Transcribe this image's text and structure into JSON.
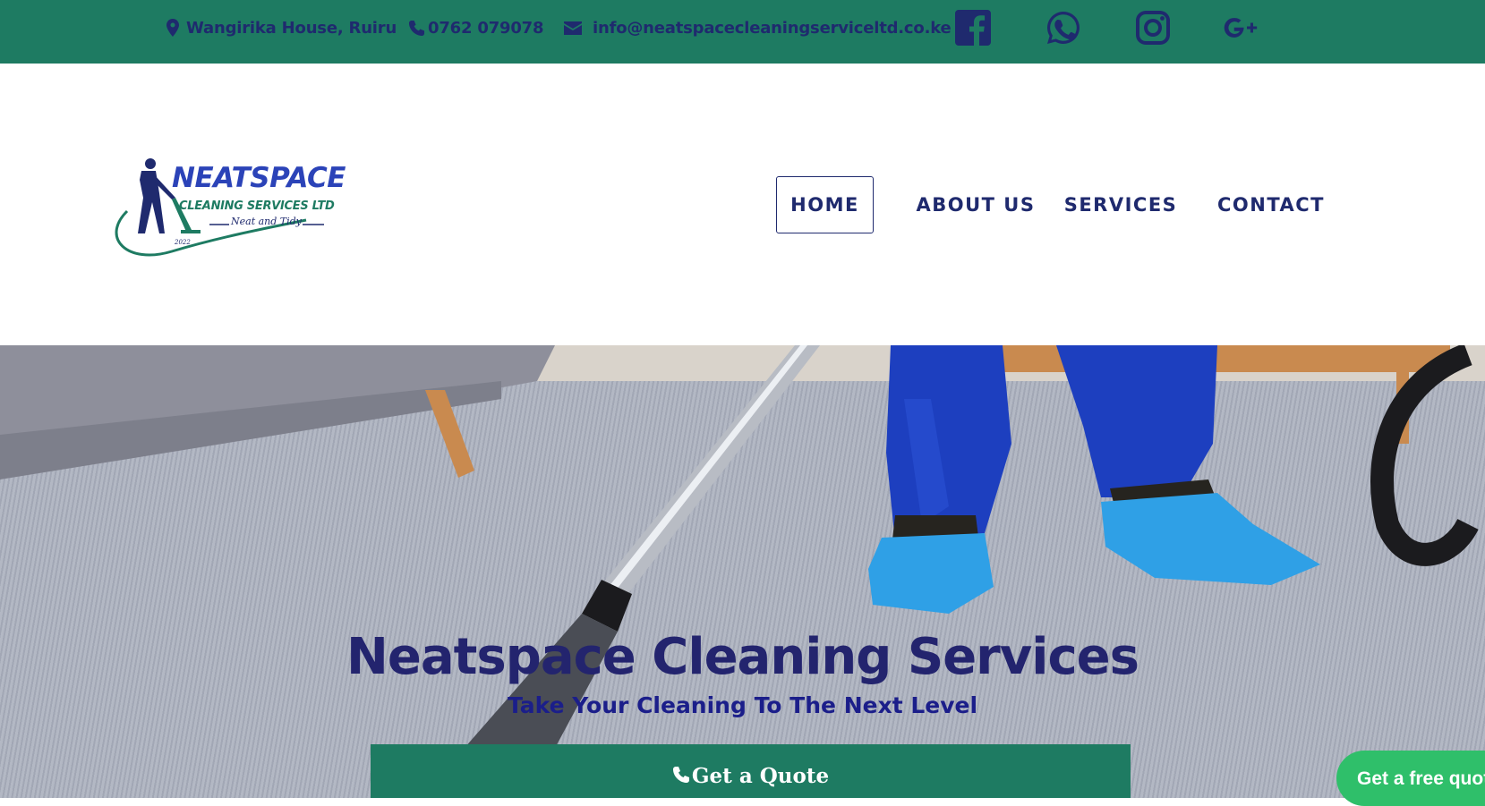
{
  "topbar": {
    "address": "Wangirika House, Ruiru",
    "phone": "0762 079078",
    "email": "info@neatspacecleaningserviceltd.co.ke",
    "social": [
      "facebook-icon",
      "whatsapp-icon",
      "instagram-icon",
      "google-plus-icon"
    ],
    "bg_color": "#1e7b62",
    "text_color": "#1f2a6e"
  },
  "logo": {
    "name": "NEATSPACE",
    "subtitle": "CLEANING SERVICES LTD",
    "tagline": "Neat and Tidy"
  },
  "nav": {
    "items": [
      "HOME",
      "ABOUT US",
      "SERVICES",
      "CONTACT"
    ],
    "active": "HOME"
  },
  "hero": {
    "title": "Neatspace Cleaning Services",
    "subtitle": "Take Your Cleaning To The Next Level",
    "cta_label": "Get a Quote",
    "cta_color": "#1e7b62"
  },
  "floating": {
    "label": "Get a free quote",
    "color": "#2fbf6a"
  }
}
